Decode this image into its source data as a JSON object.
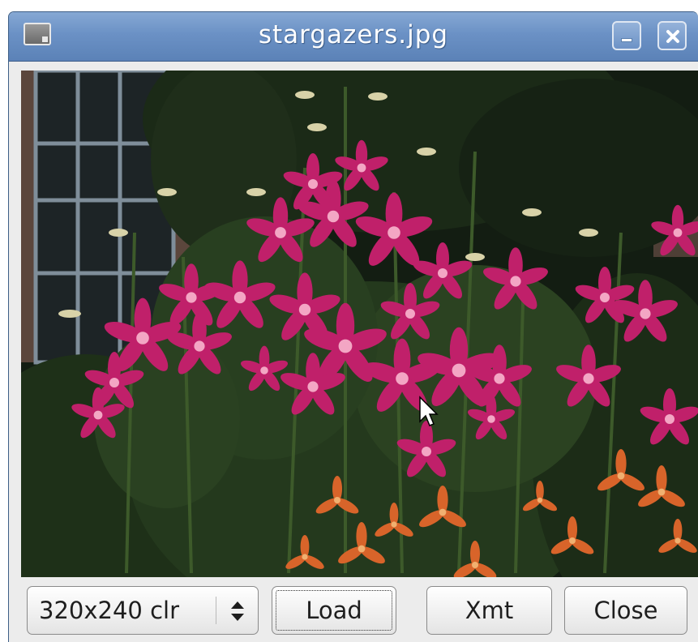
{
  "window": {
    "title": "stargazers.jpg"
  },
  "image": {
    "alt": "Photo of pink stargazer lilies and orange daylilies in front of a brick house with a window"
  },
  "controls": {
    "resolution_select": {
      "value": "320x240 clr"
    },
    "load_label": "Load",
    "xmt_label": "Xmt",
    "close_label": "Close"
  },
  "colors": {
    "titlebar": "#6b91c5",
    "background": "#ececec"
  }
}
